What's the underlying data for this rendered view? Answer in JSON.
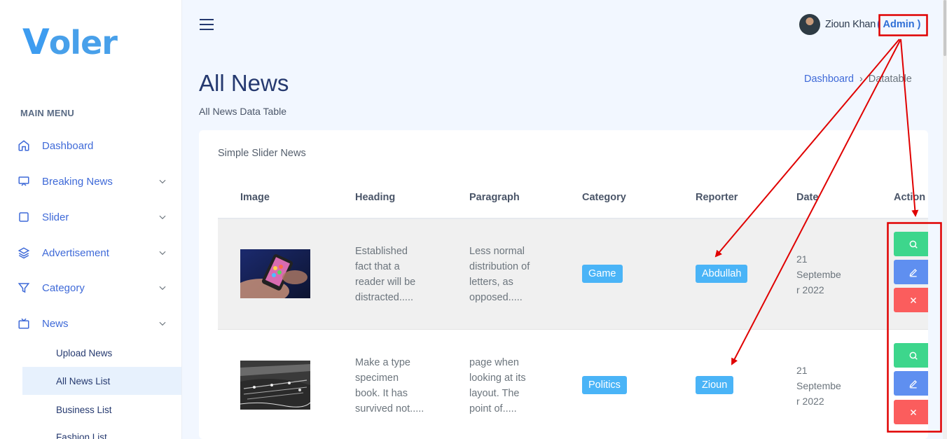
{
  "app": {
    "logo_initial": "V",
    "logo_rest": "oler"
  },
  "sidebar": {
    "menu_title": "MAIN MENU",
    "items": [
      {
        "label": "Dashboard",
        "icon": "home-icon",
        "has_children": false
      },
      {
        "label": "Breaking News",
        "icon": "monitor-icon",
        "has_children": true
      },
      {
        "label": "Slider",
        "icon": "square-icon",
        "has_children": true
      },
      {
        "label": "Advertisement",
        "icon": "layers-icon",
        "has_children": true
      },
      {
        "label": "Category",
        "icon": "filter-icon",
        "has_children": true
      },
      {
        "label": "News",
        "icon": "tv-icon",
        "has_children": true
      }
    ],
    "sub_items": [
      {
        "label": "Upload News",
        "active": false
      },
      {
        "label": "All News List",
        "active": true
      },
      {
        "label": "Business List",
        "active": false
      },
      {
        "label": "Fashion List",
        "active": false
      }
    ]
  },
  "topbar": {
    "user_name": "Zioun Khan",
    "user_role": "( Admin )"
  },
  "header": {
    "title": "All News",
    "subtitle": "All News Data Table",
    "breadcrumb": {
      "link": "Dashboard",
      "separator": "›",
      "current": "Datatable"
    }
  },
  "card": {
    "title": "Simple Slider News",
    "columns": [
      "Image",
      "Heading",
      "Paragraph",
      "Category",
      "Reporter",
      "Date",
      "Action"
    ],
    "rows": [
      {
        "heading": [
          "Established",
          "fact that a",
          "reader will be",
          "distracted....."
        ],
        "paragraph": [
          "Less normal",
          "distribution of",
          "letters, as",
          "opposed....."
        ],
        "category": "Game",
        "reporter": "Abdullah",
        "date": [
          "21",
          "Septembe",
          "r 2022"
        ]
      },
      {
        "heading": [
          "Make a type",
          "specimen",
          "book. It has",
          "survived not....."
        ],
        "paragraph": [
          "page when",
          "looking at its",
          "layout. The",
          "point of....."
        ],
        "category": "Politics",
        "reporter": "Zioun",
        "date": [
          "21",
          "Septembe",
          "r 2022"
        ]
      }
    ]
  },
  "colors": {
    "accent": "#3f6ad8",
    "badge": "#4ab4f7",
    "view": "#3dd68c",
    "edit": "#5f8ff0",
    "delete": "#fb5d5d",
    "annotation": "#e00000"
  }
}
